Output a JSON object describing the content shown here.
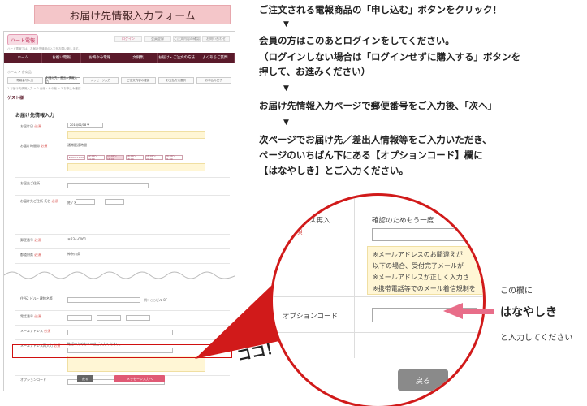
{
  "banner": {
    "title": "お届け先情報入力フォーム"
  },
  "site": {
    "logo_text": "ハート電報",
    "top_links": [
      "ログイン",
      "会員登録",
      "ご注文内容の確認",
      "お問い合わせ"
    ],
    "header_note": "ハート電報では、お届け先情報の入力をお願い致します。",
    "nav": [
      "ホーム",
      "お祝い電報",
      "お悔やみ電報",
      "文例集",
      "お届け・ご注文の方法",
      "よくあるご質問"
    ],
    "breadcrumb": "ホーム > 各商品",
    "steps": [
      "電報番号入力",
      "お届け先・差出人情報入力",
      "メッセージ入力",
      "ご注文内容の確認",
      "お支払方法選択",
      "お申込み完了"
    ],
    "step_note": "1.お届け先情報入力 > 2.台紙・その他 > 3.お申込み確認",
    "section_title": "ゲスト様",
    "form_title": "お届け先情報入力",
    "back_label": "戻る",
    "next_label": "メッセージ入力へ"
  },
  "form_rows": [
    {
      "label": "お届け日",
      "required": true,
      "value": "2016/02/18 ▼"
    },
    {
      "label": "お届け時間帯",
      "required": true,
      "value": "通常配達時間"
    },
    {
      "label": "お届先ご住所",
      "required": false,
      "value": ""
    },
    {
      "label": "お届け先ご住所 氏名",
      "required": true,
      "value": "姓 / 名"
    },
    {
      "label": "郵便番号",
      "required": true,
      "value": "〒234-0061"
    },
    {
      "label": "都道府県",
      "required": true,
      "value": "神奈川県"
    },
    {
      "label": "住所2 ビル・建物名等",
      "required": false,
      "value": "例：○○ビル 8F"
    },
    {
      "label": "電話番号",
      "required": true,
      "value": ""
    },
    {
      "label": "メールアドレス",
      "required": true,
      "value": ""
    },
    {
      "label": "メールアドレス再入力",
      "required": true,
      "value": "確認のためもう一度ご入力ください。"
    },
    {
      "label": "オプションコード",
      "required": false,
      "value": ""
    }
  ],
  "time_chips": [
    "8:00〜12:00",
    "12:00〜14:00",
    "14:00〜16:00",
    "16:00〜18:00",
    "18:00〜20:00",
    "20:00〜21:00"
  ],
  "instructions": {
    "line1": "ご注文される電報商品の「申し込む」ボタンをクリック！",
    "arrow": "▼",
    "line2a": "会員の方はこのあとログインをしてください。",
    "line2b": "（ログインしない場合は「ログインせずに購入する」ボタンを",
    "line2c": "押して、お進みください）",
    "line3": "お届け先情報入力ページで郵便番号をご入力後、「次へ」",
    "line4a": "次ページでお届け先／差出人情報等をご入力いただき、",
    "line4b": "ページのいちばん下にある【オプションコード】欄に",
    "line4c": "【はなやしき】とご入力ください。"
  },
  "magnifier": {
    "email_label": "ドレス再入",
    "email_req": "須",
    "confirm_text": "確認のためもう一度",
    "note1": "※メールアドレスのお間違えが",
    "note2": "以下の場合、受付完了メールが",
    "note3": "※メールアドレスが正しく入力さ",
    "note4": "※携帯電話等でのメール着信規制を",
    "option_label": "オプションコード",
    "back_label": "戻る"
  },
  "callout": {
    "koko": "ココ！",
    "side1": "この欄に",
    "side2": "はなやしき",
    "side3": "と入力してください"
  },
  "colors": {
    "accent_pink": "#e86d89",
    "callout_red": "#d11a1a",
    "nav_bg": "#5a1a2a"
  }
}
